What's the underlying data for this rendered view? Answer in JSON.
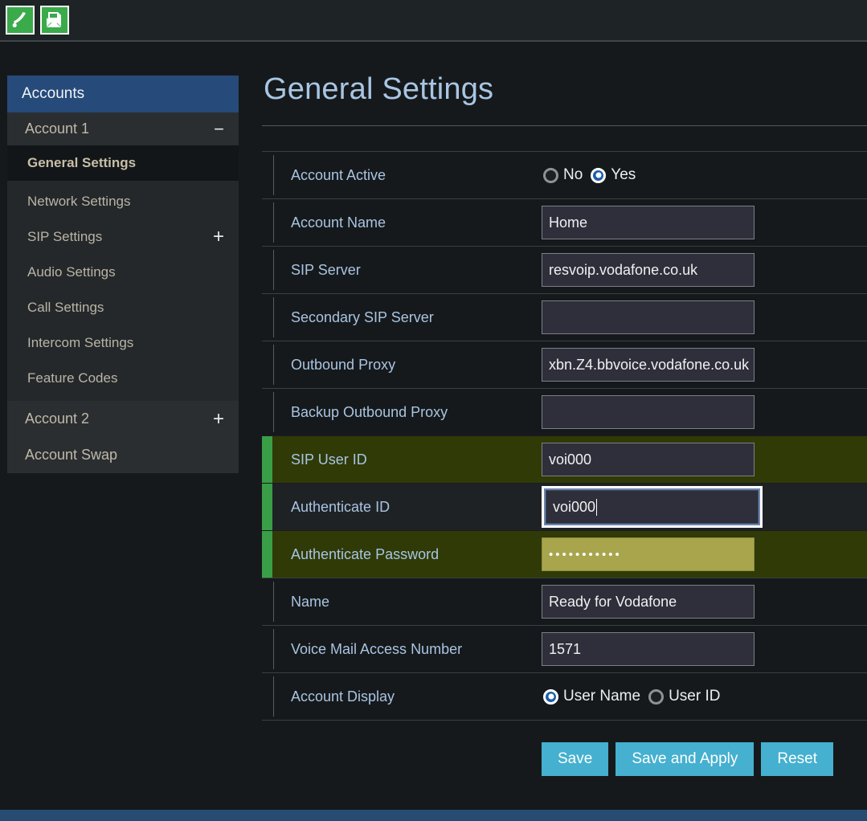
{
  "toolbar": {
    "icons": [
      {
        "name": "phone-icon",
        "label": "Phone"
      },
      {
        "name": "voicemail-message-icon",
        "label": "Messages"
      }
    ],
    "accent_color": "#3aaa4a"
  },
  "sidebar": {
    "header": "Accounts",
    "header_color": "#264a79",
    "account1": {
      "label": "Account 1",
      "toggle": "−"
    },
    "active_item": "General Settings",
    "sub_items": [
      {
        "label": "Network Settings",
        "toggle": ""
      },
      {
        "label": "SIP Settings",
        "toggle": "+"
      },
      {
        "label": "Audio Settings",
        "toggle": ""
      },
      {
        "label": "Call Settings",
        "toggle": ""
      },
      {
        "label": "Intercom Settings",
        "toggle": ""
      },
      {
        "label": "Feature Codes",
        "toggle": ""
      }
    ],
    "account2": {
      "label": "Account 2",
      "toggle": "+"
    },
    "account_swap": {
      "label": "Account Swap"
    }
  },
  "main": {
    "title": "General Settings",
    "rows": {
      "account_active": {
        "label": "Account Active",
        "options": [
          {
            "label": "No",
            "selected": false
          },
          {
            "label": "Yes",
            "selected": true
          }
        ]
      },
      "account_name": {
        "label": "Account Name",
        "value": "Home"
      },
      "sip_server": {
        "label": "SIP Server",
        "value": "resvoip.vodafone.co.uk"
      },
      "secondary_sip_server": {
        "label": "Secondary SIP Server",
        "value": ""
      },
      "outbound_proxy": {
        "label": "Outbound Proxy",
        "value": "xbn.Z4.bbvoice.vodafone.co.uk"
      },
      "backup_outbound_proxy": {
        "label": "Backup Outbound Proxy",
        "value": ""
      },
      "sip_user_id": {
        "label": "SIP User ID",
        "value": "voi000",
        "highlighted": true
      },
      "authenticate_id": {
        "label": "Authenticate ID",
        "value": "voi000",
        "focused": true,
        "highlighted": true
      },
      "authenticate_password": {
        "label": "Authenticate Password",
        "value": "•••••••••••",
        "highlighted": true
      },
      "name": {
        "label": "Name",
        "value": "Ready for Vodafone"
      },
      "voice_mail_access_number": {
        "label": "Voice Mail Access Number",
        "value": "1571"
      },
      "account_display": {
        "label": "Account Display",
        "options": [
          {
            "label": "User Name",
            "selected": true
          },
          {
            "label": "User ID",
            "selected": false
          }
        ]
      }
    },
    "buttons": {
      "save": "Save",
      "save_and_apply": "Save and Apply",
      "reset": "Reset"
    },
    "colors": {
      "label_blue": "#a8c4e2",
      "button_cyan": "#45b0cf",
      "highlight_green": "#2f3a06",
      "accent_bar_green": "#3a9e47",
      "password_field": "#a8a54c",
      "footer_blue": "#284b72"
    }
  }
}
